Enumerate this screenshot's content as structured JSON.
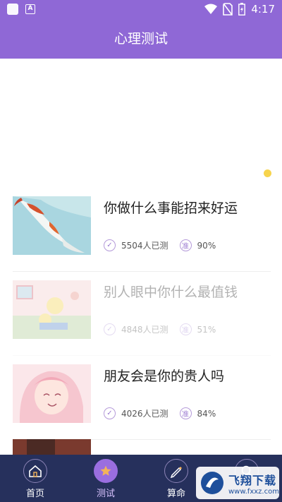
{
  "status_bar": {
    "time": "4:17",
    "left_badge": "A"
  },
  "header": {
    "title": "心理测试"
  },
  "tests": [
    {
      "title": "你做什么事能招来好运",
      "count": "5504人已测",
      "rate": "90%",
      "rate_icon": "准"
    },
    {
      "title": "别人眼中你什么最值钱",
      "count": "4848人已测",
      "rate": "51%",
      "rate_icon": "准"
    },
    {
      "title": "朋友会是你的贵人吗",
      "count": "4026人已测",
      "rate": "84%",
      "rate_icon": "准"
    }
  ],
  "tabbar": [
    {
      "label": "首页",
      "icon": "home-icon"
    },
    {
      "label": "测试",
      "icon": "star-icon",
      "active": true
    },
    {
      "label": "算命",
      "icon": "pen-icon"
    },
    {
      "label": "",
      "icon": "search-icon"
    }
  ],
  "watermark": {
    "main": "飞翔下载",
    "sub": "www.fxxz.com"
  },
  "colors": {
    "header": "#8f68d6",
    "tabbar": "#26305c",
    "accent": "#9a6ee0",
    "dot": "#f7d44c"
  }
}
